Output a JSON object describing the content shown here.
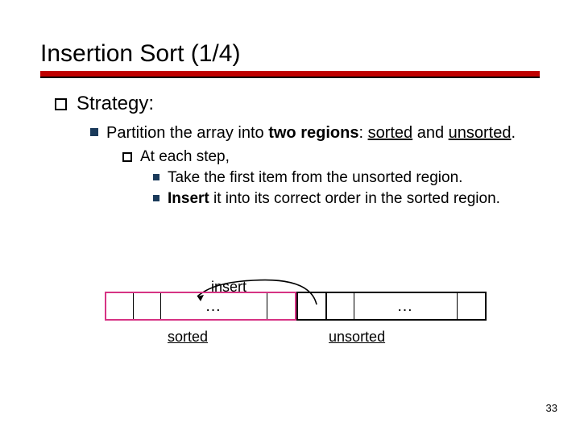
{
  "title": "Insertion Sort (1/4)",
  "bullets": {
    "l1": "Strategy:",
    "l2_pre": "Partition the array into ",
    "l2_bold": "two regions",
    "l2_mid": ": ",
    "l2_u1": "sorted",
    "l2_and": " and ",
    "l2_u2": "unsorted",
    "l2_end": ".",
    "l3": "At each step,",
    "l4a": "Take the first item from the unsorted region.",
    "l4b_bold": "Insert",
    "l4b_rest": " it into its correct order in the sorted region."
  },
  "diagram": {
    "insert_label": "insert",
    "dots": "…",
    "sorted_label": "sorted",
    "unsorted_label": "unsorted"
  },
  "page_number": "33"
}
